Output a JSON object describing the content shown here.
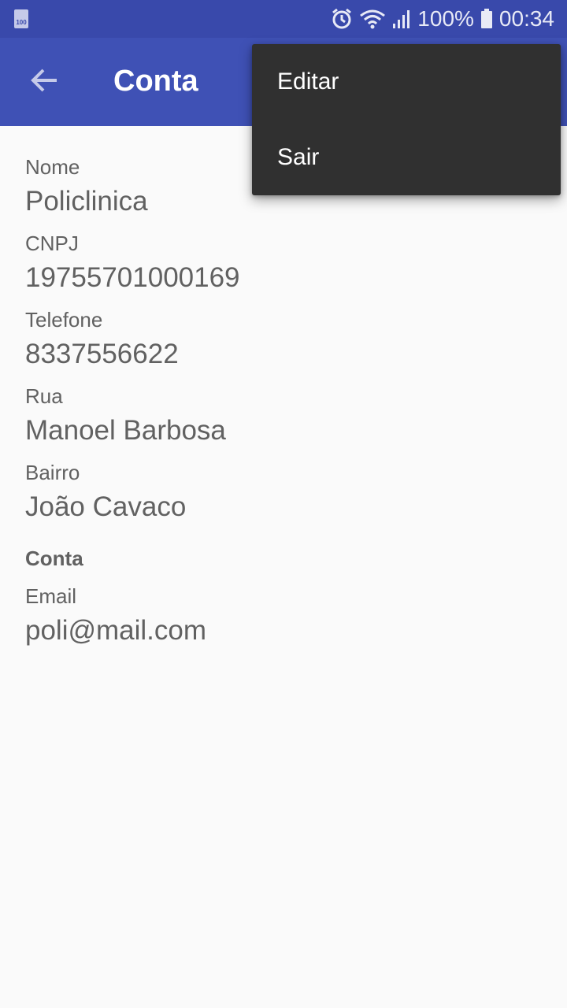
{
  "status_bar": {
    "battery_indicator_text": "100",
    "battery_percent": "100%",
    "time": "00:34",
    "icons": [
      "battery-saver-icon",
      "alarm-icon",
      "wifi-icon",
      "signal-icon",
      "battery-icon"
    ]
  },
  "toolbar": {
    "title": "Conta",
    "back_icon": "arrow-back-icon",
    "background_color": "#3f51b5"
  },
  "fields": {
    "nome": {
      "label": "Nome",
      "value": "Policlinica"
    },
    "cnpj": {
      "label": "CNPJ",
      "value": "19755701000169"
    },
    "telefone": {
      "label": "Telefone",
      "value": "8337556622"
    },
    "rua": {
      "label": "Rua",
      "value": "Manoel Barbosa"
    },
    "bairro": {
      "label": "Bairro",
      "value": "João Cavaco"
    }
  },
  "account_section": {
    "title": "Conta",
    "email": {
      "label": "Email",
      "value": "poli@mail.com"
    }
  },
  "overflow_menu": {
    "items": [
      {
        "label": "Editar"
      },
      {
        "label": "Sair"
      }
    ]
  }
}
